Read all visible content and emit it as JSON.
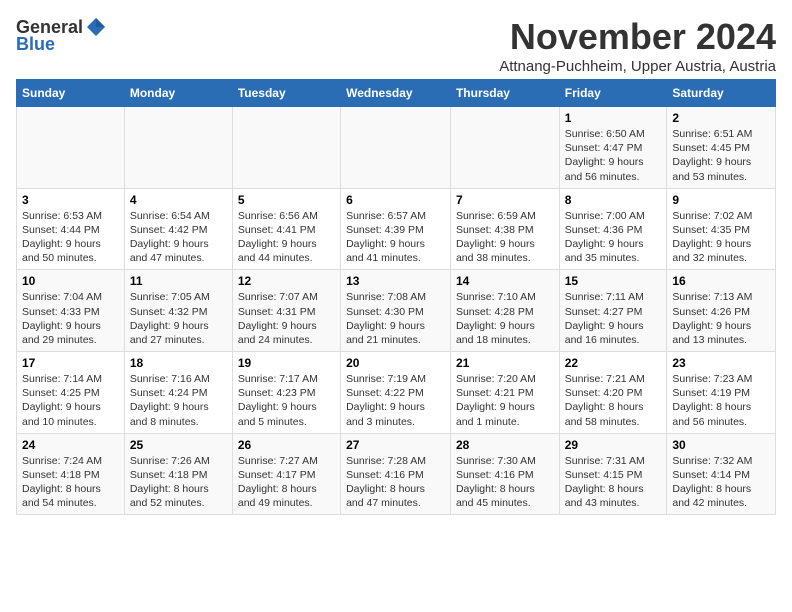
{
  "logo": {
    "general": "General",
    "blue": "Blue"
  },
  "title": "November 2024",
  "subtitle": "Attnang-Puchheim, Upper Austria, Austria",
  "days_of_week": [
    "Sunday",
    "Monday",
    "Tuesday",
    "Wednesday",
    "Thursday",
    "Friday",
    "Saturday"
  ],
  "weeks": [
    [
      {
        "day": "",
        "info": ""
      },
      {
        "day": "",
        "info": ""
      },
      {
        "day": "",
        "info": ""
      },
      {
        "day": "",
        "info": ""
      },
      {
        "day": "",
        "info": ""
      },
      {
        "day": "1",
        "info": "Sunrise: 6:50 AM\nSunset: 4:47 PM\nDaylight: 9 hours and 56 minutes."
      },
      {
        "day": "2",
        "info": "Sunrise: 6:51 AM\nSunset: 4:45 PM\nDaylight: 9 hours and 53 minutes."
      }
    ],
    [
      {
        "day": "3",
        "info": "Sunrise: 6:53 AM\nSunset: 4:44 PM\nDaylight: 9 hours and 50 minutes."
      },
      {
        "day": "4",
        "info": "Sunrise: 6:54 AM\nSunset: 4:42 PM\nDaylight: 9 hours and 47 minutes."
      },
      {
        "day": "5",
        "info": "Sunrise: 6:56 AM\nSunset: 4:41 PM\nDaylight: 9 hours and 44 minutes."
      },
      {
        "day": "6",
        "info": "Sunrise: 6:57 AM\nSunset: 4:39 PM\nDaylight: 9 hours and 41 minutes."
      },
      {
        "day": "7",
        "info": "Sunrise: 6:59 AM\nSunset: 4:38 PM\nDaylight: 9 hours and 38 minutes."
      },
      {
        "day": "8",
        "info": "Sunrise: 7:00 AM\nSunset: 4:36 PM\nDaylight: 9 hours and 35 minutes."
      },
      {
        "day": "9",
        "info": "Sunrise: 7:02 AM\nSunset: 4:35 PM\nDaylight: 9 hours and 32 minutes."
      }
    ],
    [
      {
        "day": "10",
        "info": "Sunrise: 7:04 AM\nSunset: 4:33 PM\nDaylight: 9 hours and 29 minutes."
      },
      {
        "day": "11",
        "info": "Sunrise: 7:05 AM\nSunset: 4:32 PM\nDaylight: 9 hours and 27 minutes."
      },
      {
        "day": "12",
        "info": "Sunrise: 7:07 AM\nSunset: 4:31 PM\nDaylight: 9 hours and 24 minutes."
      },
      {
        "day": "13",
        "info": "Sunrise: 7:08 AM\nSunset: 4:30 PM\nDaylight: 9 hours and 21 minutes."
      },
      {
        "day": "14",
        "info": "Sunrise: 7:10 AM\nSunset: 4:28 PM\nDaylight: 9 hours and 18 minutes."
      },
      {
        "day": "15",
        "info": "Sunrise: 7:11 AM\nSunset: 4:27 PM\nDaylight: 9 hours and 16 minutes."
      },
      {
        "day": "16",
        "info": "Sunrise: 7:13 AM\nSunset: 4:26 PM\nDaylight: 9 hours and 13 minutes."
      }
    ],
    [
      {
        "day": "17",
        "info": "Sunrise: 7:14 AM\nSunset: 4:25 PM\nDaylight: 9 hours and 10 minutes."
      },
      {
        "day": "18",
        "info": "Sunrise: 7:16 AM\nSunset: 4:24 PM\nDaylight: 9 hours and 8 minutes."
      },
      {
        "day": "19",
        "info": "Sunrise: 7:17 AM\nSunset: 4:23 PM\nDaylight: 9 hours and 5 minutes."
      },
      {
        "day": "20",
        "info": "Sunrise: 7:19 AM\nSunset: 4:22 PM\nDaylight: 9 hours and 3 minutes."
      },
      {
        "day": "21",
        "info": "Sunrise: 7:20 AM\nSunset: 4:21 PM\nDaylight: 9 hours and 1 minute."
      },
      {
        "day": "22",
        "info": "Sunrise: 7:21 AM\nSunset: 4:20 PM\nDaylight: 8 hours and 58 minutes."
      },
      {
        "day": "23",
        "info": "Sunrise: 7:23 AM\nSunset: 4:19 PM\nDaylight: 8 hours and 56 minutes."
      }
    ],
    [
      {
        "day": "24",
        "info": "Sunrise: 7:24 AM\nSunset: 4:18 PM\nDaylight: 8 hours and 54 minutes."
      },
      {
        "day": "25",
        "info": "Sunrise: 7:26 AM\nSunset: 4:18 PM\nDaylight: 8 hours and 52 minutes."
      },
      {
        "day": "26",
        "info": "Sunrise: 7:27 AM\nSunset: 4:17 PM\nDaylight: 8 hours and 49 minutes."
      },
      {
        "day": "27",
        "info": "Sunrise: 7:28 AM\nSunset: 4:16 PM\nDaylight: 8 hours and 47 minutes."
      },
      {
        "day": "28",
        "info": "Sunrise: 7:30 AM\nSunset: 4:16 PM\nDaylight: 8 hours and 45 minutes."
      },
      {
        "day": "29",
        "info": "Sunrise: 7:31 AM\nSunset: 4:15 PM\nDaylight: 8 hours and 43 minutes."
      },
      {
        "day": "30",
        "info": "Sunrise: 7:32 AM\nSunset: 4:14 PM\nDaylight: 8 hours and 42 minutes."
      }
    ]
  ]
}
